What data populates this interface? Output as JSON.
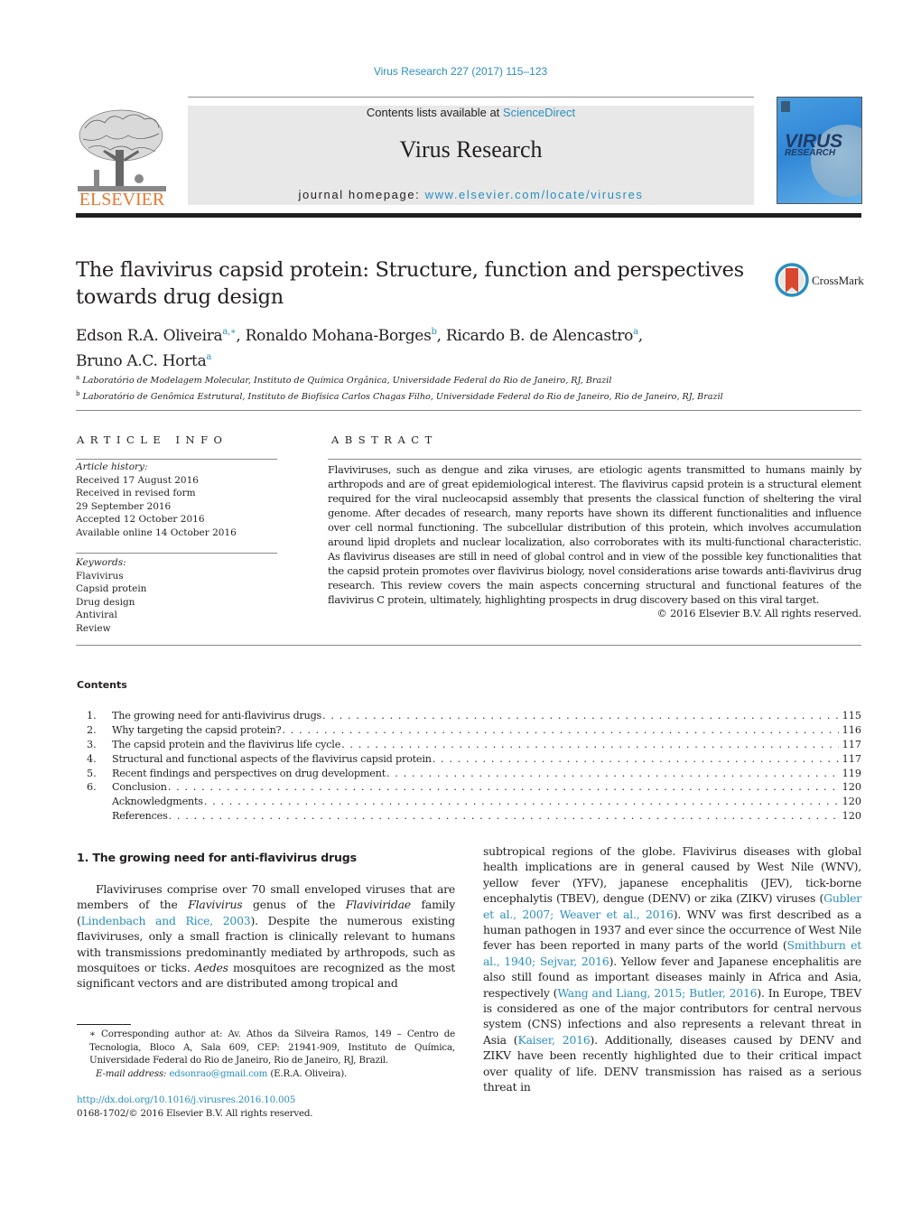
{
  "citation": "Virus Research 227 (2017) 115–123",
  "header": {
    "contents_prefix": "Contents lists available at ",
    "contents_link": "ScienceDirect",
    "journal_title": "Virus Research",
    "homepage_prefix": "journal homepage: ",
    "homepage_link": "www.elsevier.com/locate/virusres",
    "publisher_logo_text": "ELSEVIER",
    "cover_title": "VIRUS",
    "cover_subtitle": "RESEARCH",
    "crossmark_label": "CrossMark"
  },
  "article": {
    "title": "The flavivirus capsid protein: Structure, function and perspectives towards drug design",
    "authors": [
      {
        "name": "Edson R.A. Oliveira",
        "sup": "a,∗",
        "sep": ", "
      },
      {
        "name": "Ronaldo Mohana-Borges",
        "sup": "b",
        "sep": ", "
      },
      {
        "name": "Ricardo B. de Alencastro",
        "sup": "a",
        "sep": ","
      },
      {
        "name": "Bruno A.C. Horta",
        "sup": "a",
        "sep": ""
      }
    ],
    "affiliations": [
      {
        "key": "a",
        "text": "Laboratório de Modelagem Molecular, Instituto de Química Orgânica, Universidade Federal do Rio de Janeiro, RJ, Brazil"
      },
      {
        "key": "b",
        "text": "Laboratório de Genômica Estrutural, Instituto de Biofísica Carlos Chagas Filho, Universidade Federal do Rio de Janeiro, Rio de Janeiro, RJ, Brazil"
      }
    ]
  },
  "article_info": {
    "heading": "ARTICLE INFO",
    "history_label": "Article history:",
    "history": [
      "Received 17 August 2016",
      "Received in revised form",
      "29 September 2016",
      "Accepted 12 October 2016",
      "Available online 14 October 2016"
    ],
    "keywords_label": "Keywords:",
    "keywords": [
      "Flavivirus",
      "Capsid protein",
      "Drug design",
      "Antiviral",
      "Review"
    ]
  },
  "abstract": {
    "heading": "ABSTRACT",
    "text": "Flaviviruses, such as dengue and zika viruses, are etiologic agents transmitted to humans mainly by arthropods and are of great epidemiological interest. The flavivirus capsid protein is a structural element required for the viral nucleocapsid assembly that presents the classical function of sheltering the viral genome. After decades of research, many reports have shown its different functionalities and influence over cell normal functioning. The subcellular distribution of this protein, which involves accumulation around lipid droplets and nuclear localization, also corroborates with its multi-functional characteristic. As flavivirus diseases are still in need of global control and in view of the possible key functionalities that the capsid protein promotes over flavivirus biology, novel considerations arise towards anti-flavivirus drug research. This review covers the main aspects concerning structural and functional features of the flavivirus C protein, ultimately, highlighting prospects in drug discovery based on this viral target.",
    "copyright": "© 2016 Elsevier B.V. All rights reserved."
  },
  "contents": {
    "heading": "Contents",
    "items": [
      {
        "num": "1.",
        "title": "The growing need for anti-flavivirus drugs",
        "page": "115"
      },
      {
        "num": "2.",
        "title": "Why targeting the capsid protein?",
        "page": "116"
      },
      {
        "num": "3.",
        "title": "The capsid protein and the flavivirus life cycle",
        "page": "117"
      },
      {
        "num": "4.",
        "title": "Structural and functional aspects of the flavivirus capsid protein",
        "page": "117"
      },
      {
        "num": "5.",
        "title": "Recent findings and perspectives on drug development",
        "page": "119"
      },
      {
        "num": "6.",
        "title": "Conclusion",
        "page": "120"
      },
      {
        "num": "",
        "title": "Acknowledgments",
        "page": "120"
      },
      {
        "num": "",
        "title": "References",
        "page": "120"
      }
    ]
  },
  "section1": {
    "heading": "1.  The growing need for anti-flavivirus drugs",
    "col1": [
      {
        "t": "Flaviviruses comprise over 70 small enveloped viruses that are members of the "
      },
      {
        "t": "Flavivirus",
        "i": true
      },
      {
        "t": " genus of the "
      },
      {
        "t": "Flaviviridae",
        "i": true
      },
      {
        "t": " family ("
      },
      {
        "t": "Lindenbach and Rice, 2003",
        "l": true
      },
      {
        "t": "). Despite the numerous existing flaviviruses, only a small fraction is clinically relevant to humans with transmissions predominantly mediated by arthropods, such as mosquitoes or ticks. "
      },
      {
        "t": "Aedes",
        "i": true
      },
      {
        "t": " mosquitoes are recognized as the most significant vectors and are distributed among tropical and"
      }
    ],
    "col2": [
      {
        "t": "subtropical regions of the globe. Flavivirus diseases with global health implications are in general caused by West Nile (WNV), yellow fever (YFV), japanese encephalitis (JEV), tick-borne encephalytis (TBEV), dengue (DENV) or zika (ZIKV) viruses ("
      },
      {
        "t": "Gubler et al., 2007; Weaver et al., 2016",
        "l": true
      },
      {
        "t": "). WNV was first described as a human pathogen in 1937 and ever since the occurrence of West Nile fever has been reported in many parts of the world ("
      },
      {
        "t": "Smithburn et al., 1940; Sejvar, 2016",
        "l": true
      },
      {
        "t": "). Yellow fever and Japanese encephalitis are also still found as important diseases mainly in Africa and Asia, respectively ("
      },
      {
        "t": "Wang and Liang, 2015; Butler, 2016",
        "l": true
      },
      {
        "t": "). In Europe, TBEV is considered as one of the major contributors for central nervous system (CNS) infections and also represents a relevant threat in Asia ("
      },
      {
        "t": "Kaiser, 2016",
        "l": true
      },
      {
        "t": "). Additionally, diseases caused by DENV and ZIKV have been recently highlighted due to their critical impact over quality of life. DENV transmission has raised as a serious threat in"
      }
    ]
  },
  "footnote": {
    "corresponding": "∗ Corresponding author at: Av. Athos da Silveira Ramos, 149 – Centro de Tecnologia, Bloco A, Sala 609, CEP: 21941-909, Instituto de Química, Universidade Federal do Rio de Janeiro, Rio de Janeiro, RJ, Brazil.",
    "email_label": "E-mail address: ",
    "email": "edsonrao@gmail.com",
    "email_owner": " (E.R.A. Oliveira).",
    "doi": "http://dx.doi.org/10.1016/j.virusres.2016.10.005",
    "issn": "0168-1702/© 2016 Elsevier B.V. All rights reserved."
  }
}
